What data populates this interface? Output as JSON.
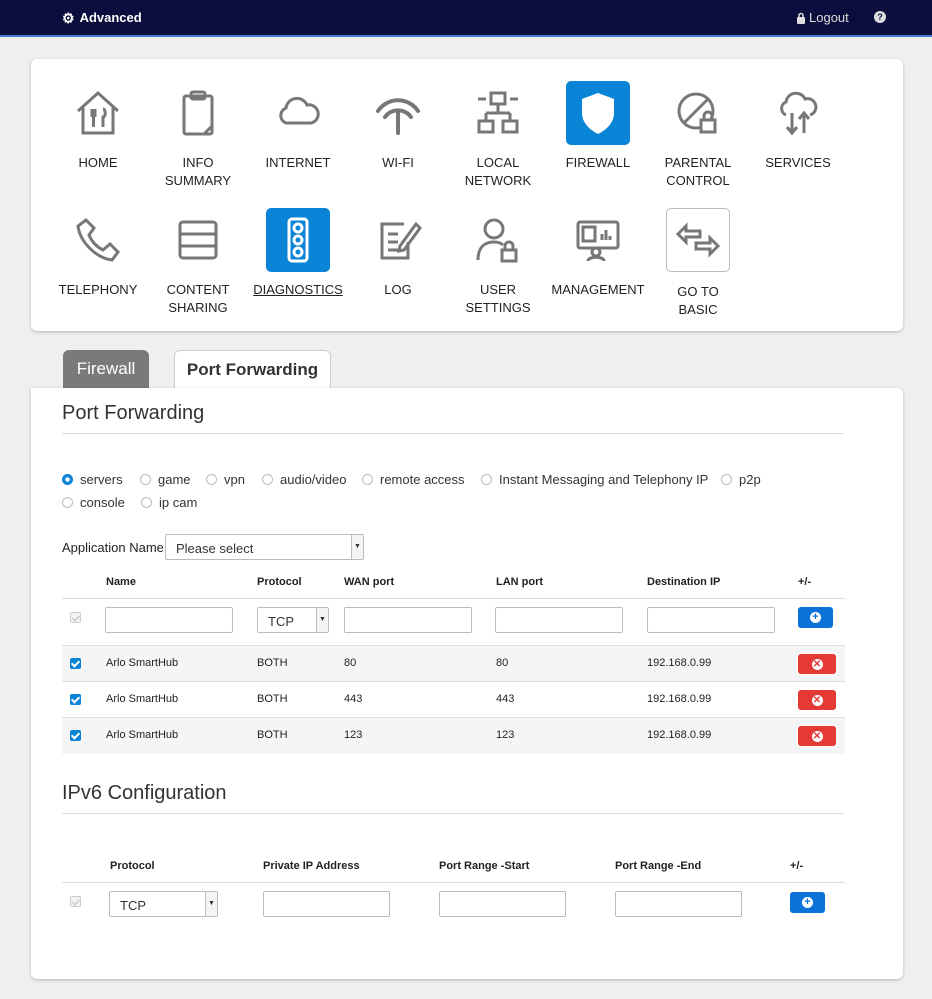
{
  "topbar": {
    "title": "Advanced",
    "logout": "Logout",
    "help": "?"
  },
  "tiles": [
    {
      "label": "HOME",
      "icon": "home-icon"
    },
    {
      "label": "INFO\nSUMMARY",
      "icon": "clipboard-icon"
    },
    {
      "label": "INTERNET",
      "icon": "cloud-icon"
    },
    {
      "label": "WI-FI",
      "icon": "wifi-icon"
    },
    {
      "label": "LOCAL\nNETWORK",
      "icon": "network-icon"
    },
    {
      "label": "FIREWALL",
      "icon": "shield-icon"
    },
    {
      "label": "PARENTAL\nCONTROL",
      "icon": "parental-lock-icon"
    },
    {
      "label": "SERVICES",
      "icon": "cloud-services-icon"
    },
    {
      "label": "TELEPHONY",
      "icon": "phone-icon"
    },
    {
      "label": "CONTENT\nSHARING",
      "icon": "storage-icon"
    },
    {
      "label": "DIAGNOSTICS",
      "icon": "traffic-light-icon"
    },
    {
      "label": "LOG",
      "icon": "log-edit-icon"
    },
    {
      "label": "USER\nSETTINGS",
      "icon": "user-lock-icon"
    },
    {
      "label": "MANAGEMENT",
      "icon": "management-screen-icon"
    },
    {
      "label": "GO TO\nBASIC",
      "icon": "arrows-swap-icon"
    }
  ],
  "tabs": {
    "firewall": "Firewall",
    "port_forwarding": "Port Forwarding"
  },
  "port_forwarding": {
    "heading": "Port Forwarding",
    "radios": [
      "servers",
      "game",
      "vpn",
      "audio/video",
      "remote access",
      "Instant Messaging and Telephony IP",
      "p2p",
      "console",
      "ip cam"
    ],
    "selected_radio": "servers",
    "app_name_label": "Application Name",
    "app_name_value": "Please select",
    "columns": [
      "Name",
      "Protocol",
      "WAN port",
      "LAN port",
      "Destination IP",
      "+/-"
    ],
    "new_row_protocol": "TCP",
    "rows": [
      {
        "name": "Arlo SmartHub",
        "protocol": "BOTH",
        "wan": "80",
        "lan": "80",
        "ip": "192.168.0.99"
      },
      {
        "name": "Arlo SmartHub",
        "protocol": "BOTH",
        "wan": "443",
        "lan": "443",
        "ip": "192.168.0.99"
      },
      {
        "name": "Arlo SmartHub",
        "protocol": "BOTH",
        "wan": "123",
        "lan": "123",
        "ip": "192.168.0.99"
      }
    ]
  },
  "ipv6": {
    "heading": "IPv6 Configuration",
    "columns": [
      "Protocol",
      "Private IP Address",
      "Port Range -Start",
      "Port Range -End",
      "+/-"
    ],
    "protocol_value": "TCP"
  },
  "colors": {
    "topbar": "#0b0d3d",
    "accent": "#0a84d6",
    "delete": "#e53935"
  }
}
